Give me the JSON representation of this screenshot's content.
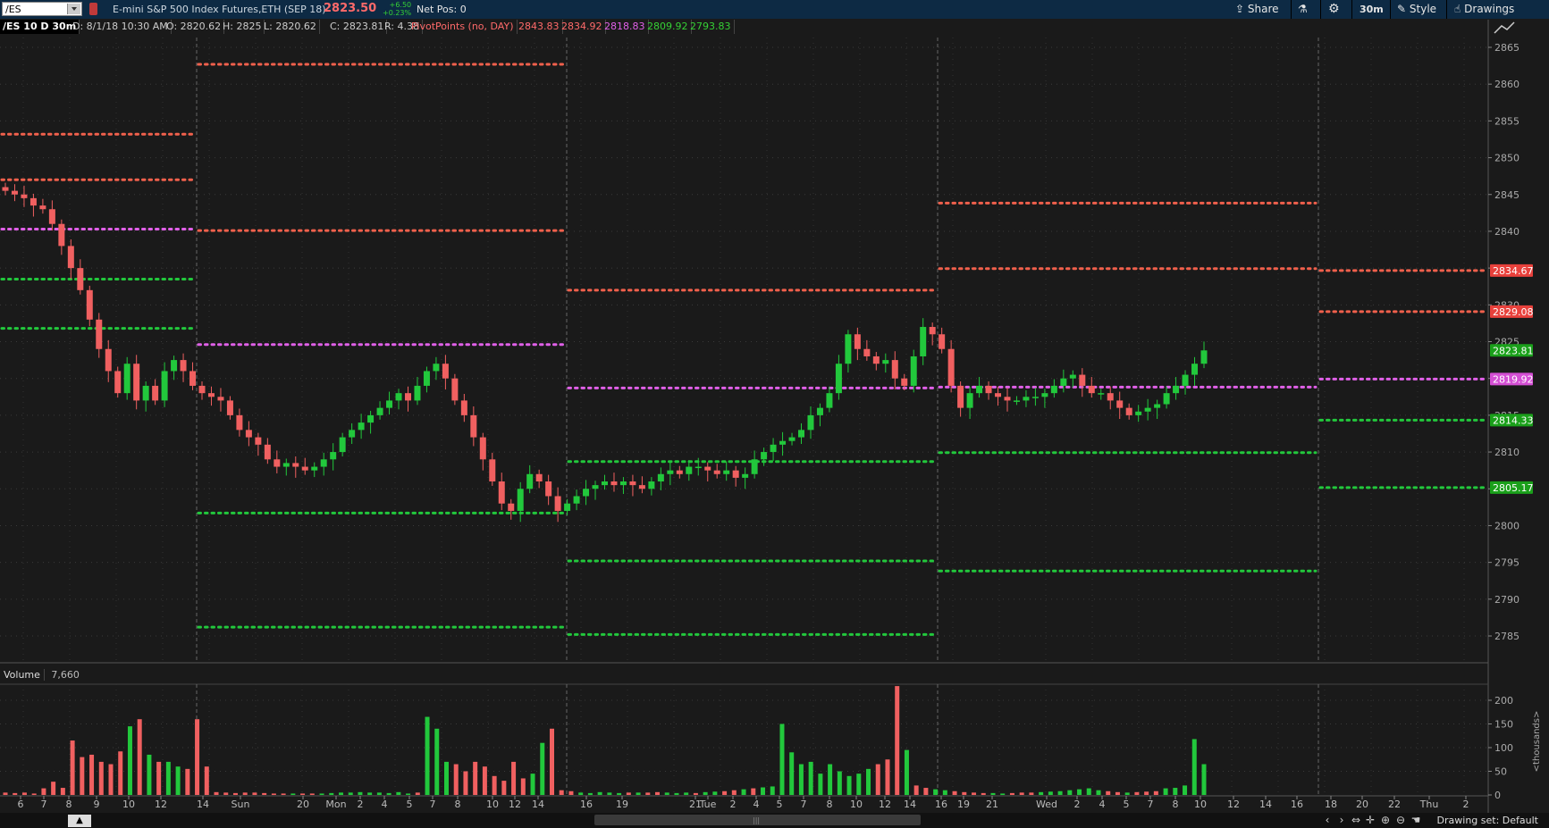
{
  "toolbar": {
    "symbol": "/ES",
    "instrument": "E-mini S&P 500 Index Futures,ETH (SEP 18)",
    "last_price": "2823.50",
    "change_abs": "+6.50",
    "change_pct": "+0.23%",
    "net_pos": "Net Pos: 0",
    "share_label": "Share",
    "timeframe_label": "30m",
    "style_label": "Style",
    "drawings_label": "Drawings",
    "icons": [
      "share-icon",
      "flask-icon",
      "gear-icon",
      "style-icon",
      "drawings-icon"
    ]
  },
  "info": {
    "chart_label": "/ES 10 D 30m",
    "date": "D: 8/1/18 10:30 AM",
    "open": "O: 2820.62",
    "high": "H: 2825",
    "low": "L: 2820.62",
    "close": "C: 2823.81",
    "range": "R: 4.38",
    "study": "PivotPoints (no, DAY)",
    "study_values": [
      "2843.83",
      "2834.92",
      "2818.83",
      "2809.92",
      "2793.83"
    ]
  },
  "price_axis": {
    "ticks": [
      "2865",
      "2860",
      "2855",
      "2850",
      "2845",
      "2840",
      "2835",
      "2830",
      "2825",
      "2820",
      "2815",
      "2810",
      "2805",
      "2800",
      "2795",
      "2790",
      "2785"
    ],
    "bubbles": [
      {
        "label": "2834.67",
        "value": 2834.67,
        "color": "#e8413c"
      },
      {
        "label": "2829.08",
        "value": 2829.08,
        "color": "#e8413c"
      },
      {
        "label": "2823.81",
        "value": 2823.81,
        "color": "#1aa01a"
      },
      {
        "label": "2819.92",
        "value": 2819.92,
        "color": "#d44fd4"
      },
      {
        "label": "2814.33",
        "value": 2814.33,
        "color": "#1aa01a"
      },
      {
        "label": "2805.17",
        "value": 2805.17,
        "color": "#1aa01a"
      }
    ]
  },
  "time_axis": {
    "ticks": [
      "6",
      "7",
      "8",
      "9",
      "10",
      "12",
      "14",
      "Sun",
      "20",
      "Mon",
      "2",
      "4",
      "5",
      "7",
      "8",
      "10",
      "12",
      "14",
      "16",
      "19",
      "21",
      "Tue",
      "2",
      "4",
      "5",
      "7",
      "8",
      "10",
      "12",
      "14",
      "16",
      "19",
      "21",
      "Wed",
      "2",
      "4",
      "5",
      "7",
      "8",
      "10",
      "12",
      "14",
      "16",
      "18",
      "20",
      "22",
      "Thu",
      "2"
    ]
  },
  "volume": {
    "label": "Volume",
    "value": "7,660",
    "axis_ticks": [
      "200",
      "150",
      "100",
      "50",
      "0"
    ],
    "unit_label": "<thousands>"
  },
  "bottom": {
    "drawing_set": "Drawing set: Default"
  },
  "colors": {
    "up": "#22c83c",
    "down": "#f06060",
    "pivot": "#e060e8",
    "resist": "#f0604c",
    "support": "#22c83c",
    "background": "#1a1a1a"
  },
  "chart_data": {
    "type": "candlestick",
    "price_range": [
      2781,
      2867
    ],
    "pivot_levels": [
      {
        "day": 1,
        "R2": 2853.2,
        "R1": 2847,
        "PP": 2840.3,
        "S1": 2833.5,
        "S2": 2826.8
      },
      {
        "day": 2,
        "R2": 2862.7,
        "R1": 2840.1,
        "PP": 2824.6,
        "S1": 2801.7,
        "S2": 2786.2
      },
      {
        "day": 3,
        "R1": 2832,
        "PP": 2818.7,
        "S1": 2808.7,
        "S2": 2795.2,
        "S3": 2785.2
      },
      {
        "day": 4,
        "R2": 2843.83,
        "R1": 2834.92,
        "PP": 2818.83,
        "S1": 2809.92,
        "S2": 2793.83
      },
      {
        "day": 5,
        "R1": 2834.67,
        "R2": 2829.08,
        "PP": 2819.92,
        "S1": 2814.33,
        "S2": 2805.17
      }
    ],
    "volume_max": 220
  }
}
